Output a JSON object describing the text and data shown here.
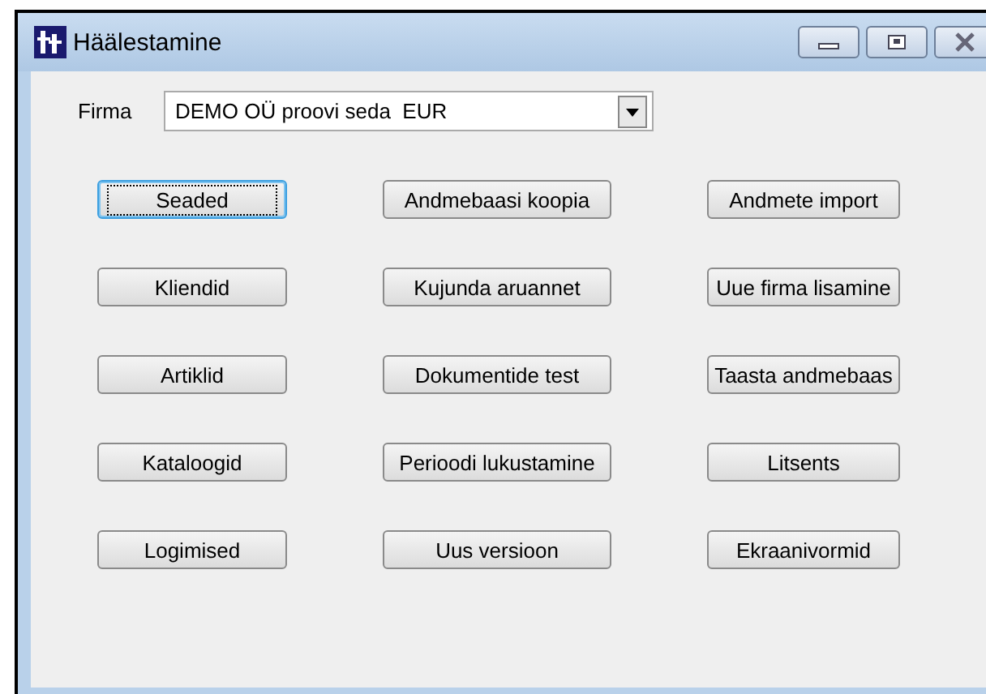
{
  "window": {
    "title": "Häälestamine"
  },
  "company": {
    "label": "Firma",
    "value": "DEMO OÜ proovi seda  EUR"
  },
  "buttons": [
    {
      "label": "Seaded",
      "focused": true
    },
    {
      "label": "Andmebaasi koopia",
      "focused": false
    },
    {
      "label": "Andmete import",
      "focused": false
    },
    {
      "label": "Kliendid",
      "focused": false
    },
    {
      "label": "Kujunda aruannet",
      "focused": false
    },
    {
      "label": "Uue firma lisamine",
      "focused": false
    },
    {
      "label": "Artiklid",
      "focused": false
    },
    {
      "label": "Dokumentide test",
      "focused": false
    },
    {
      "label": "Taasta andmebaas",
      "focused": false
    },
    {
      "label": "Kataloogid",
      "focused": false
    },
    {
      "label": "Perioodi lukustamine",
      "focused": false
    },
    {
      "label": "Litsents",
      "focused": false
    },
    {
      "label": "Logimised",
      "focused": false
    },
    {
      "label": "Uus versioon",
      "focused": false
    },
    {
      "label": "Ekraanivormid",
      "focused": false
    }
  ]
}
